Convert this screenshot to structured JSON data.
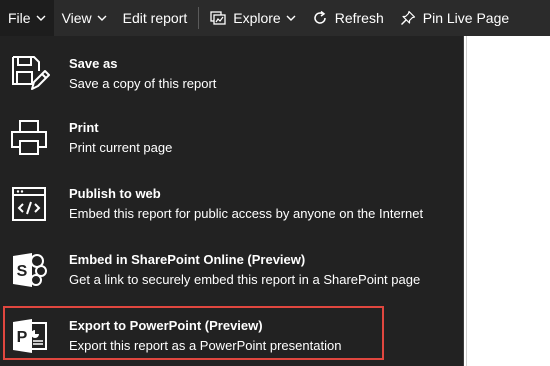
{
  "toolbar": {
    "file_label": "File",
    "view_label": "View",
    "edit_report_label": "Edit report",
    "explore_label": "Explore",
    "refresh_label": "Refresh",
    "pin_label": "Pin Live Page"
  },
  "menu": {
    "items": [
      {
        "title": "Save as",
        "desc": "Save a copy of this report",
        "icon": "save-as-icon"
      },
      {
        "title": "Print",
        "desc": "Print current page",
        "icon": "print-icon"
      },
      {
        "title": "Publish to web",
        "desc": "Embed this report for public access by anyone on the Internet",
        "icon": "publish-web-icon"
      },
      {
        "title": "Embed in SharePoint Online (Preview)",
        "desc": "Get a link to securely embed this report in a SharePoint page",
        "icon": "sharepoint-icon"
      },
      {
        "title": "Export to PowerPoint (Preview)",
        "desc": "Export this report as a PowerPoint presentation",
        "icon": "powerpoint-icon"
      }
    ]
  },
  "colors": {
    "toolbar_bg": "#2b2b2b",
    "menu_bg": "#222222",
    "highlight_border": "#e0473f"
  }
}
